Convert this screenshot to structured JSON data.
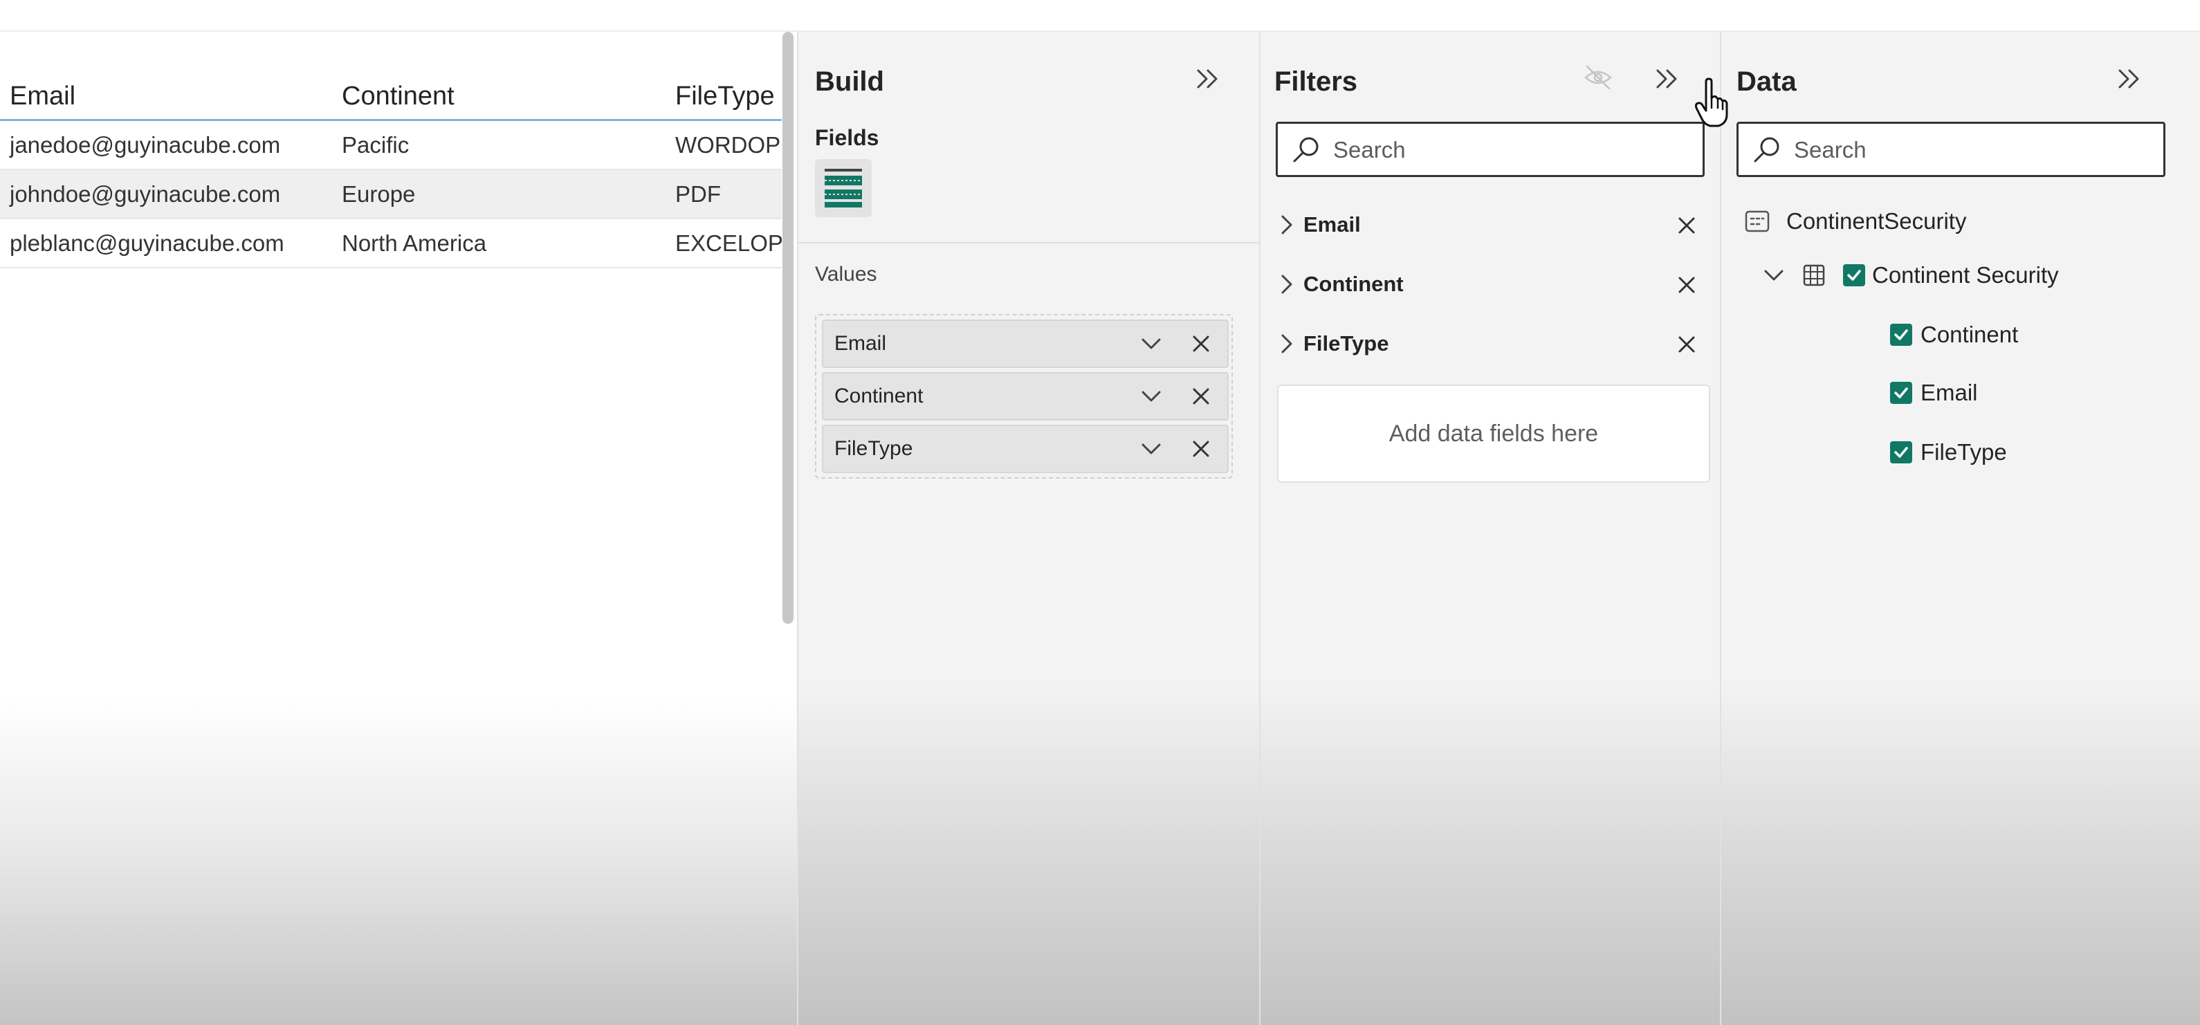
{
  "table": {
    "columns": [
      "Email",
      "Continent",
      "FileType"
    ],
    "rows": [
      [
        "janedoe@guyinacube.com",
        "Pacific",
        "WORDOPDF"
      ],
      [
        "johndoe@guyinacube.com",
        "Europe",
        "PDF"
      ],
      [
        "pleblanc@guyinacube.com",
        "North America",
        "EXCELOPDF"
      ]
    ]
  },
  "build": {
    "title": "Build",
    "fields_label": "Fields",
    "values_label": "Values",
    "values": [
      {
        "label": "Email"
      },
      {
        "label": "Continent"
      },
      {
        "label": "FileType"
      }
    ]
  },
  "filters": {
    "title": "Filters",
    "search_placeholder": "Search",
    "items": [
      {
        "label": "Email"
      },
      {
        "label": "Continent"
      },
      {
        "label": "FileType"
      }
    ],
    "dropzone": "Add data fields here"
  },
  "data": {
    "title": "Data",
    "search_placeholder": "Search",
    "model_name": "ContinentSecurity",
    "table_name": "Continent Security",
    "fields": [
      {
        "label": "Continent",
        "checked": true
      },
      {
        "label": "Email",
        "checked": true
      },
      {
        "label": "FileType",
        "checked": true
      }
    ]
  },
  "colors": {
    "accent_teal": "#117865",
    "header_underline": "#7fb6dc"
  },
  "icons": [
    "search-icon",
    "chevron-right-icon",
    "chevron-down-icon",
    "close-icon",
    "double-chevron-right-icon",
    "eye-hidden-icon",
    "table-icon",
    "model-icon",
    "checkbox-checked-icon",
    "hand-cursor-icon",
    "table-visual-icon"
  ]
}
